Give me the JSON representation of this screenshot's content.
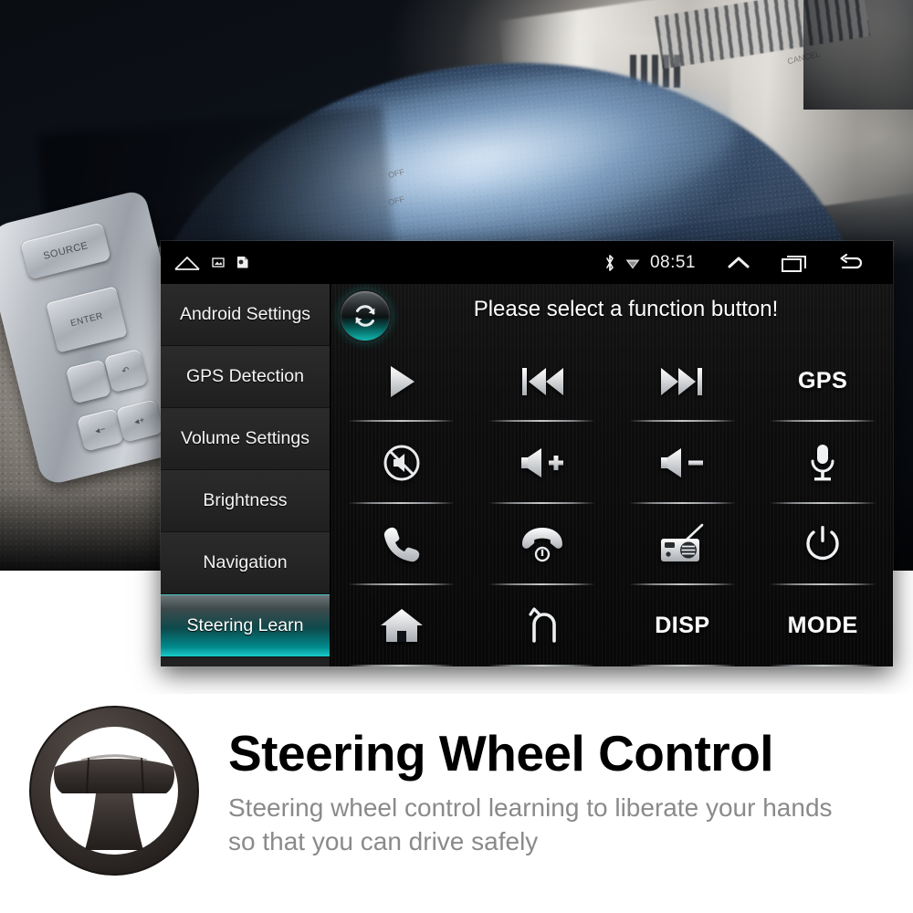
{
  "photo": {
    "wheel_buttons": [
      {
        "name": "source",
        "label": "SOURCE"
      },
      {
        "name": "enter",
        "label": "ENTER"
      },
      {
        "name": "screen",
        "label": ""
      },
      {
        "name": "back",
        "label": "↶"
      },
      {
        "name": "volume-down",
        "label": "◂−"
      },
      {
        "name": "volume-up",
        "label": "◂+"
      }
    ],
    "cruise_labels": [
      "CANCEL",
      "OFF",
      "OFF"
    ]
  },
  "statusbar": {
    "home_icon": "home-outline-icon",
    "notif_icons": [
      "screenshot-icon",
      "sd-card-icon"
    ],
    "bluetooth_icon": "bluetooth-icon",
    "wifi_icon": "wifi-icon",
    "time": "08:51",
    "nav_icons": [
      "chevron-up-icon",
      "recents-icon",
      "back-icon"
    ]
  },
  "sidebar": {
    "items": [
      {
        "label": "Android Settings",
        "active": false
      },
      {
        "label": "GPS Detection",
        "active": false
      },
      {
        "label": "Volume Settings",
        "active": false
      },
      {
        "label": "Brightness",
        "active": false
      },
      {
        "label": "Navigation",
        "active": false
      },
      {
        "label": "Steering Learn",
        "active": true
      }
    ]
  },
  "main": {
    "reset_icon": "refresh-sync-icon",
    "prompt": "Please select a function button!",
    "buttons": [
      {
        "name": "play",
        "icon": "play-icon",
        "text": ""
      },
      {
        "name": "previous",
        "icon": "previous-track-icon",
        "text": ""
      },
      {
        "name": "next",
        "icon": "next-track-icon",
        "text": ""
      },
      {
        "name": "gps",
        "icon": "",
        "text": "GPS"
      },
      {
        "name": "mute",
        "icon": "mute-icon",
        "text": ""
      },
      {
        "name": "volume-up",
        "icon": "volume-up-icon",
        "text": ""
      },
      {
        "name": "volume-down",
        "icon": "volume-down-icon",
        "text": ""
      },
      {
        "name": "voice",
        "icon": "microphone-icon",
        "text": ""
      },
      {
        "name": "answer-call",
        "icon": "phone-icon",
        "text": ""
      },
      {
        "name": "hang-up",
        "icon": "hang-up-icon",
        "text": ""
      },
      {
        "name": "radio",
        "icon": "radio-icon",
        "text": ""
      },
      {
        "name": "power",
        "icon": "power-icon",
        "text": ""
      },
      {
        "name": "home",
        "icon": "house-icon",
        "text": ""
      },
      {
        "name": "back",
        "icon": "back-arrow-icon",
        "text": ""
      },
      {
        "name": "disp",
        "icon": "",
        "text": "DISP"
      },
      {
        "name": "mode",
        "icon": "",
        "text": "MODE"
      }
    ]
  },
  "branding": {
    "logo_icon": "steering-wheel-icon",
    "title": "Steering Wheel Control",
    "subtitle": "Steering wheel control learning to liberate your hands so that you can drive safely"
  },
  "colors": {
    "accent_teal": "#0fb8ae",
    "panel_bg": "#000000",
    "sidebar_bg": "#242424",
    "text_white": "#f4f4f4",
    "subtitle_gray": "#8a8a8a"
  }
}
